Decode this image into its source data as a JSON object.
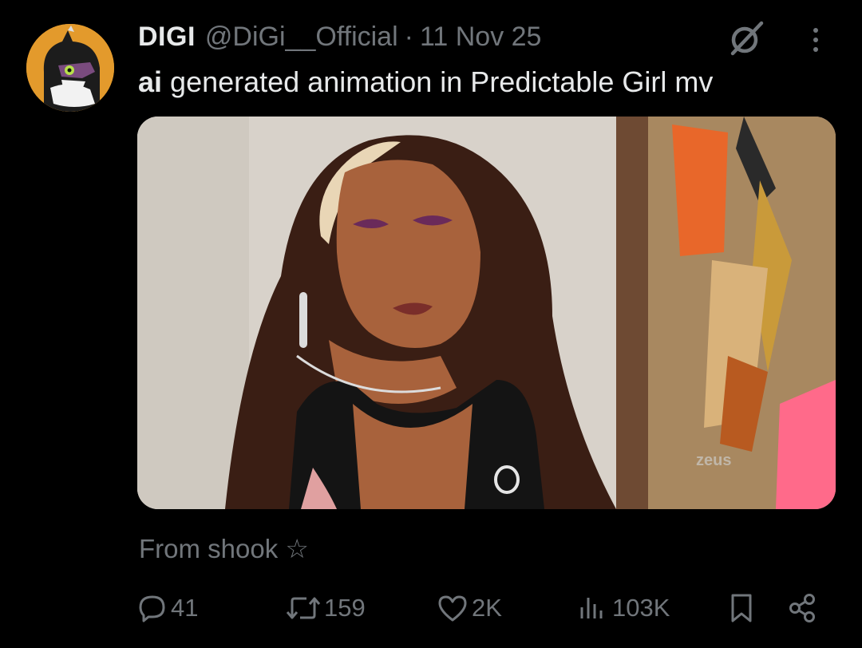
{
  "post": {
    "author_name": "DIGI",
    "author_handle": "@DiGi__Official",
    "separator": "·",
    "date": "11 Nov 25",
    "text_bold": "ai",
    "text_rest": "generated animation in Predictable Girl mv"
  },
  "media": {
    "watermark": "zeus",
    "sound_icon": "speaker-sound-icon"
  },
  "source": {
    "label": "From shook ☆"
  },
  "actions": {
    "replies": "41",
    "reposts": "159",
    "likes": "2K",
    "views": "103K"
  },
  "colors": {
    "background": "#000000",
    "primary_text": "#e7e9ea",
    "secondary_text": "#71767b",
    "avatar_bg": "#e39a2c"
  }
}
